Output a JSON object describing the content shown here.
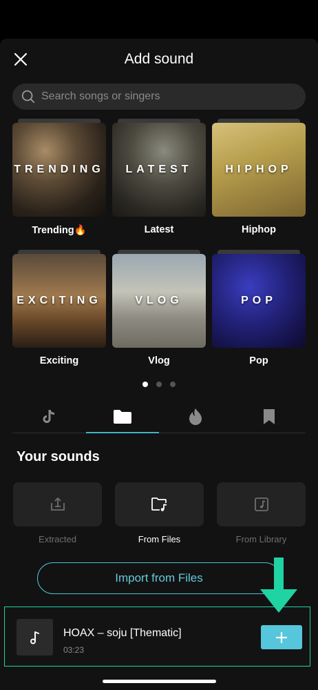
{
  "header": {
    "title": "Add sound"
  },
  "search": {
    "placeholder": "Search songs or singers"
  },
  "categories": [
    {
      "overlay": "TRENDING",
      "label": "Trending🔥"
    },
    {
      "overlay": "LATEST",
      "label": "Latest"
    },
    {
      "overlay": "HIPHOP",
      "label": "Hiphop"
    },
    {
      "overlay": "EXCITING",
      "label": "Exciting"
    },
    {
      "overlay": "VLOG",
      "label": "Vlog"
    },
    {
      "overlay": "POP",
      "label": "Pop"
    }
  ],
  "pagination": {
    "pages": 3,
    "active_page": 1
  },
  "tabs": [
    {
      "icon": "tiktok-icon",
      "active": false
    },
    {
      "icon": "folder-icon",
      "active": true
    },
    {
      "icon": "fire-icon",
      "active": false
    },
    {
      "icon": "bookmark-icon",
      "active": false
    }
  ],
  "your_sounds": {
    "title": "Your sounds",
    "sources": [
      {
        "label": "Extracted",
        "icon": "extract-icon",
        "enabled": false
      },
      {
        "label": "From Files",
        "icon": "folder-music-icon",
        "enabled": true
      },
      {
        "label": "From Library",
        "icon": "music-library-icon",
        "enabled": false
      }
    ],
    "import_label": "Import from Files"
  },
  "song": {
    "title": "HOAX – soju [Thematic]",
    "duration": "03:23",
    "icon": "music-note-icon"
  },
  "colors": {
    "accent": "#56c6dc",
    "highlight": "#20d3a3",
    "background": "#121212"
  }
}
